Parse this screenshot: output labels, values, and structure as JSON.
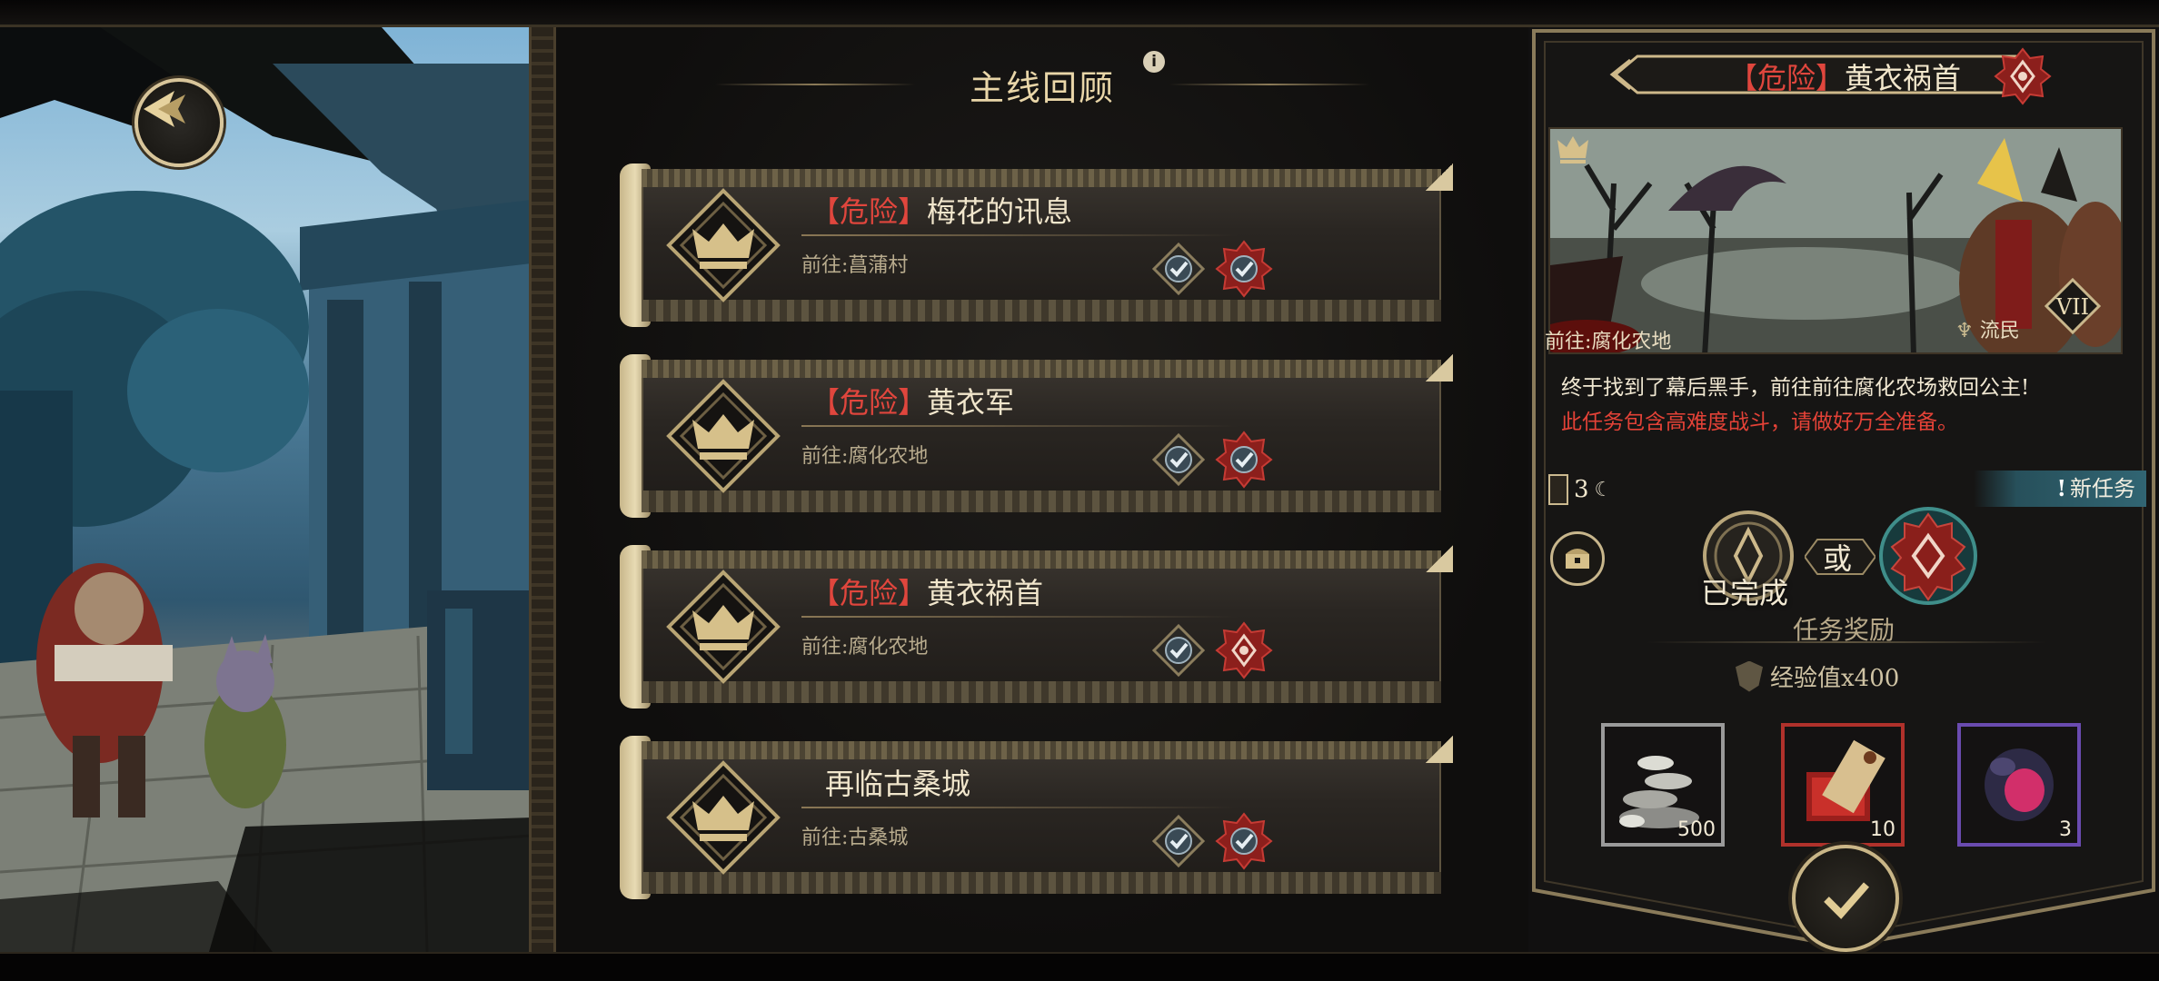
{
  "center": {
    "title": "主线回顾",
    "info_symbol": "i"
  },
  "quests": [
    {
      "prefix": "【危险】",
      "name": "梅花的讯息",
      "destination": "前往:菖蒲村"
    },
    {
      "prefix": "【危险】",
      "name": "黄衣军",
      "destination": "前往:腐化农地"
    },
    {
      "prefix": "【危险】",
      "name": "黄衣祸首",
      "destination": "前往:腐化农地"
    },
    {
      "prefix": "",
      "name": "再临古桑城",
      "destination": "前往:古桑城"
    }
  ],
  "detail": {
    "prefix": "【危险】",
    "title": "黄衣祸首",
    "destination": "前往:腐化农地",
    "faction": "流民",
    "rank": "VII",
    "description": "终于找到了幕后黑手，前往前往腐化农场救回公主!",
    "warning": "此任务包含高难度战斗，请做好万全准备。",
    "timer_value": "3",
    "new_badge_mark": "!",
    "new_badge": "新任务",
    "option_completed": "已完成",
    "or_label": "或",
    "reward_title": "任务奖励",
    "exp_label": "经验值x400",
    "rewards": [
      {
        "icon": "coins-icon",
        "count": "500",
        "frame_color": "#9a9a9a"
      },
      {
        "icon": "scroll-icon",
        "count": "10",
        "frame_color": "#b0312b"
      },
      {
        "icon": "relic-icon",
        "count": "3",
        "frame_color": "#6a4bb0"
      }
    ]
  },
  "colors": {
    "danger": "#e0463d",
    "gold": "#d8c59a",
    "new_badge": "#316573"
  }
}
